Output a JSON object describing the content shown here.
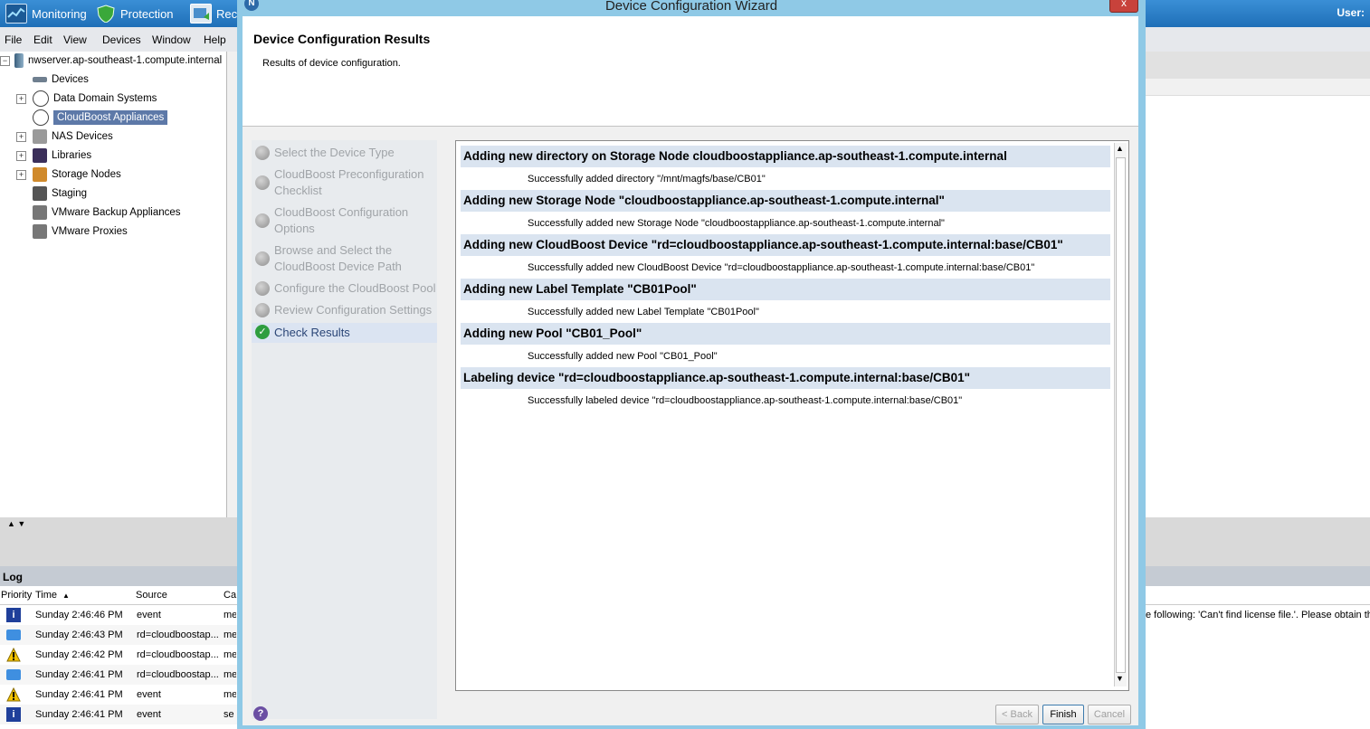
{
  "topbar": {
    "monitoring": "Monitoring",
    "protection": "Protection",
    "recover": "Reco",
    "user": "User:"
  },
  "menu": [
    "File",
    "Edit",
    "View",
    "Devices",
    "Window",
    "Help"
  ],
  "tree": {
    "root": "nwserver.ap-southeast-1.compute.internal",
    "items": [
      "Devices",
      "Data Domain Systems",
      "CloudBoost Appliances",
      "NAS Devices",
      "Libraries",
      "Storage Nodes",
      "Staging",
      "VMware Backup Appliances",
      "VMware Proxies"
    ],
    "selected": "CloudBoost Appliances"
  },
  "log": {
    "title": "Log",
    "columns": [
      "Priority",
      "Time",
      "Source",
      "Ca"
    ],
    "rows": [
      {
        "priority": "info",
        "time": "Sunday 2:46:46 PM",
        "source": "event",
        "cat": "me"
      },
      {
        "priority": "message",
        "time": "Sunday 2:46:43 PM",
        "source": "rd=cloudboostap...",
        "cat": "me"
      },
      {
        "priority": "warning",
        "time": "Sunday 2:46:42 PM",
        "source": "rd=cloudboostap...",
        "cat": "me"
      },
      {
        "priority": "message",
        "time": "Sunday 2:46:41 PM",
        "source": "rd=cloudboostap...",
        "cat": "me"
      },
      {
        "priority": "warning",
        "time": "Sunday 2:46:41 PM",
        "source": "event",
        "cat": "me"
      },
      {
        "priority": "info",
        "time": "Sunday 2:46:41 PM",
        "source": "event",
        "cat": "se"
      }
    ],
    "right_text": "e following: 'Can't find license file.'. Please obtain th"
  },
  "dialog": {
    "title": "Device Configuration Wizard",
    "close": "x",
    "header_title": "Device Configuration Results",
    "header_sub": "Results of device configuration.",
    "steps": [
      {
        "label": "Select the Device Type",
        "active": false
      },
      {
        "label": "CloudBoost Preconfiguration Checklist",
        "active": false
      },
      {
        "label": "CloudBoost Configuration Options",
        "active": false
      },
      {
        "label": "Browse and Select the CloudBoost Device Path",
        "active": false
      },
      {
        "label": "Configure the CloudBoost Pool",
        "active": false
      },
      {
        "label": "Review Configuration Settings",
        "active": false
      },
      {
        "label": "Check Results",
        "active": true
      }
    ],
    "results": [
      {
        "heading": "Adding new directory on Storage Node cloudboostappliance.ap-southeast-1.compute.internal",
        "message": "Successfully added directory \"/mnt/magfs/base/CB01\""
      },
      {
        "heading": "Adding new Storage Node \"cloudboostappliance.ap-southeast-1.compute.internal\"",
        "message": "Successfully added new Storage Node \"cloudboostappliance.ap-southeast-1.compute.internal\""
      },
      {
        "heading": "Adding new CloudBoost Device \"rd=cloudboostappliance.ap-southeast-1.compute.internal:base/CB01\"",
        "message": "Successfully added new CloudBoost Device \"rd=cloudboostappliance.ap-southeast-1.compute.internal:base/CB01\""
      },
      {
        "heading": "Adding new Label Template \"CB01Pool\"",
        "message": "Successfully added new Label Template \"CB01Pool\""
      },
      {
        "heading": "Adding new Pool \"CB01_Pool\"",
        "message": "Successfully added new Pool \"CB01_Pool\""
      },
      {
        "heading": "Labeling device \"rd=cloudboostappliance.ap-southeast-1.compute.internal:base/CB01\"",
        "message": "Successfully labeled device \"rd=cloudboostappliance.ap-southeast-1.compute.internal:base/CB01\""
      }
    ],
    "buttons": {
      "back": "< Back",
      "finish": "Finish",
      "cancel": "Cancel",
      "help": "?"
    }
  },
  "colors": {
    "topbar": "#2a7dc6",
    "dialog_frame": "#8fc9e6",
    "selected_tree": "#5d79a8",
    "success": "#2f9e3f"
  }
}
